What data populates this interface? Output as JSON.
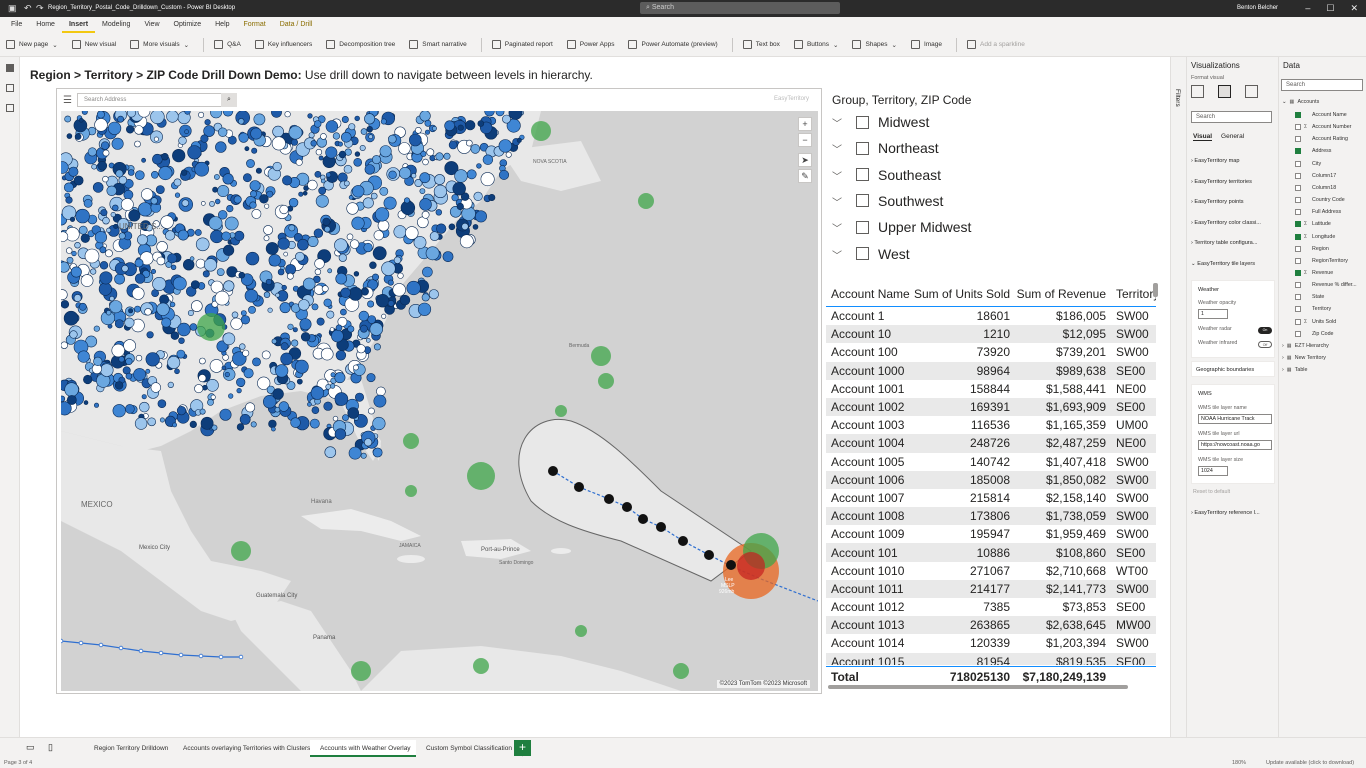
{
  "window": {
    "title": "Region_Territory_Postal_Code_Drilldown_Custom - Power BI Desktop",
    "search_placeholder": "Search",
    "user": "Benton Belcher"
  },
  "menu": [
    "File",
    "Home",
    "Insert",
    "Modeling",
    "View",
    "Optimize",
    "Help",
    "Format",
    "Data / Drill"
  ],
  "menu_active": "Insert",
  "ribbon": [
    {
      "label": "New page",
      "dropdown": true
    },
    {
      "label": "New visual"
    },
    {
      "label": "More visuals",
      "dropdown": true
    },
    {
      "label": "Q&A"
    },
    {
      "label": "Key influencers"
    },
    {
      "label": "Decomposition tree"
    },
    {
      "label": "Smart narrative"
    },
    {
      "label": "Paginated report"
    },
    {
      "label": "Power Apps"
    },
    {
      "label": "Power Automate (preview)"
    },
    {
      "label": "Text box"
    },
    {
      "label": "Buttons",
      "dropdown": true
    },
    {
      "label": "Shapes",
      "dropdown": true
    },
    {
      "label": "Image"
    },
    {
      "label": "Add a sparkline",
      "disabled": true
    }
  ],
  "page": {
    "title_bold": "Region > Territory > ZIP Code Drill Down Demo:",
    "title_rest": " Use drill down to navigate between levels in hierarchy."
  },
  "map": {
    "search_placeholder": "Search Address",
    "logo_text": "EasyTerritory",
    "copyright": "©2023 TomTom ©2023 Microsoft",
    "hurricane_label": "Lee\nMSLP\n926mb",
    "place_labels": [
      "UNITED S...",
      "MEXICO",
      "Havana",
      "Mexico City",
      "Guatemala City",
      "Panama",
      "Port-au-Prince",
      "Santo Domingo",
      "JAMAICA",
      "NOVA SCOTIA",
      "Bermuda"
    ]
  },
  "slicer": {
    "title": "Group, Territory, ZIP Code",
    "items": [
      "Midwest",
      "Northeast",
      "Southeast",
      "Southwest",
      "Upper Midwest",
      "West"
    ]
  },
  "table": {
    "columns": [
      "Account Name",
      "Sum of Units Sold",
      "Sum of Revenue",
      "Territory"
    ],
    "rows": [
      [
        "Account 1",
        "18601",
        "$186,005",
        "SW00"
      ],
      [
        "Account 10",
        "1210",
        "$12,095",
        "SW00"
      ],
      [
        "Account 100",
        "73920",
        "$739,201",
        "SW00"
      ],
      [
        "Account 1000",
        "98964",
        "$989,638",
        "SE00"
      ],
      [
        "Account 1001",
        "158844",
        "$1,588,441",
        "NE00"
      ],
      [
        "Account 1002",
        "169391",
        "$1,693,909",
        "SE00"
      ],
      [
        "Account 1003",
        "116536",
        "$1,165,359",
        "UM00"
      ],
      [
        "Account 1004",
        "248726",
        "$2,487,259",
        "NE00"
      ],
      [
        "Account 1005",
        "140742",
        "$1,407,418",
        "SW00"
      ],
      [
        "Account 1006",
        "185008",
        "$1,850,082",
        "SW00"
      ],
      [
        "Account 1007",
        "215814",
        "$2,158,140",
        "SW00"
      ],
      [
        "Account 1008",
        "173806",
        "$1,738,059",
        "SW00"
      ],
      [
        "Account 1009",
        "195947",
        "$1,959,469",
        "SW00"
      ],
      [
        "Account 101",
        "10886",
        "$108,860",
        "SE00"
      ],
      [
        "Account 1010",
        "271067",
        "$2,710,668",
        "WT00"
      ],
      [
        "Account 1011",
        "214177",
        "$2,141,773",
        "SW00"
      ],
      [
        "Account 1012",
        "7385",
        "$73,853",
        "SE00"
      ],
      [
        "Account 1013",
        "263865",
        "$2,638,645",
        "MW00"
      ],
      [
        "Account 1014",
        "120339",
        "$1,203,394",
        "SW00"
      ],
      [
        "Account 1015",
        "81954",
        "$819,535",
        "SE00"
      ]
    ],
    "total": [
      "Total",
      "718025130",
      "$7,180,249,139",
      ""
    ]
  },
  "filters_label": "Filters",
  "viz": {
    "title": "Visualizations",
    "sub": "Format visual",
    "search": "Search",
    "tabs": [
      "Visual",
      "General"
    ],
    "sections": [
      "EasyTerritory map",
      "EasyTerritory territories",
      "EasyTerritory points",
      "EasyTerritory color classi...",
      "Territory table configura...",
      "EasyTerritory tile layers"
    ],
    "weather": {
      "header": "Weather",
      "opacity_label": "Weather opacity",
      "opacity_value": "1",
      "radar_label": "Weather radar",
      "radar_state": "On",
      "infrared_label": "Weather infrared",
      "infrared_state": "Off"
    },
    "geo": "Geographic boundaries",
    "wms": {
      "header": "WMS",
      "name_label": "WMS tile layer name",
      "name_value": "NOAA Hurricane Track",
      "url_label": "WMS tile layer url",
      "url_value": "https://nowcoast.noaa.go",
      "size_label": "WMS tile layer size",
      "size_value": "1024"
    },
    "reset": "Reset to default",
    "ref": "EasyTerritory reference l..."
  },
  "data": {
    "title": "Data",
    "search": "Search",
    "table": "Accounts",
    "fields": [
      {
        "name": "Account Name",
        "checked": true,
        "sigma": false
      },
      {
        "name": "Account Number",
        "checked": false,
        "sigma": true
      },
      {
        "name": "Account Rating",
        "checked": false,
        "sigma": false
      },
      {
        "name": "Address",
        "checked": true,
        "sigma": false
      },
      {
        "name": "City",
        "checked": false,
        "sigma": false
      },
      {
        "name": "Column17",
        "checked": false,
        "sigma": false
      },
      {
        "name": "Column18",
        "checked": false,
        "sigma": false
      },
      {
        "name": "Country Code",
        "checked": false,
        "sigma": false
      },
      {
        "name": "Full Address",
        "checked": false,
        "sigma": false
      },
      {
        "name": "Latitude",
        "checked": true,
        "sigma": true
      },
      {
        "name": "Longitude",
        "checked": true,
        "sigma": true
      },
      {
        "name": "Region",
        "checked": false,
        "sigma": false
      },
      {
        "name": "RegionTerritory",
        "checked": false,
        "sigma": false
      },
      {
        "name": "Revenue",
        "checked": true,
        "sigma": true
      },
      {
        "name": "Revenue % differ...",
        "checked": false,
        "sigma": false
      },
      {
        "name": "State",
        "checked": false,
        "sigma": false
      },
      {
        "name": "Territory",
        "checked": false,
        "sigma": false
      },
      {
        "name": "Units Sold",
        "checked": false,
        "sigma": true
      },
      {
        "name": "Zip Code",
        "checked": false,
        "sigma": false
      }
    ],
    "other_tables": [
      "EZT Hierarchy",
      "New Territory",
      "Table"
    ]
  },
  "page_tabs": [
    "Region Territory Drilldown",
    "Accounts overlaying Territories with Clusters",
    "Accounts with Weather Overlay",
    "Custom Symbol Classification"
  ],
  "page_tab_active": "Accounts with Weather Overlay",
  "status": {
    "page": "Page 3 of 4",
    "zoom": "180%",
    "update": "Update available (click to download)"
  }
}
